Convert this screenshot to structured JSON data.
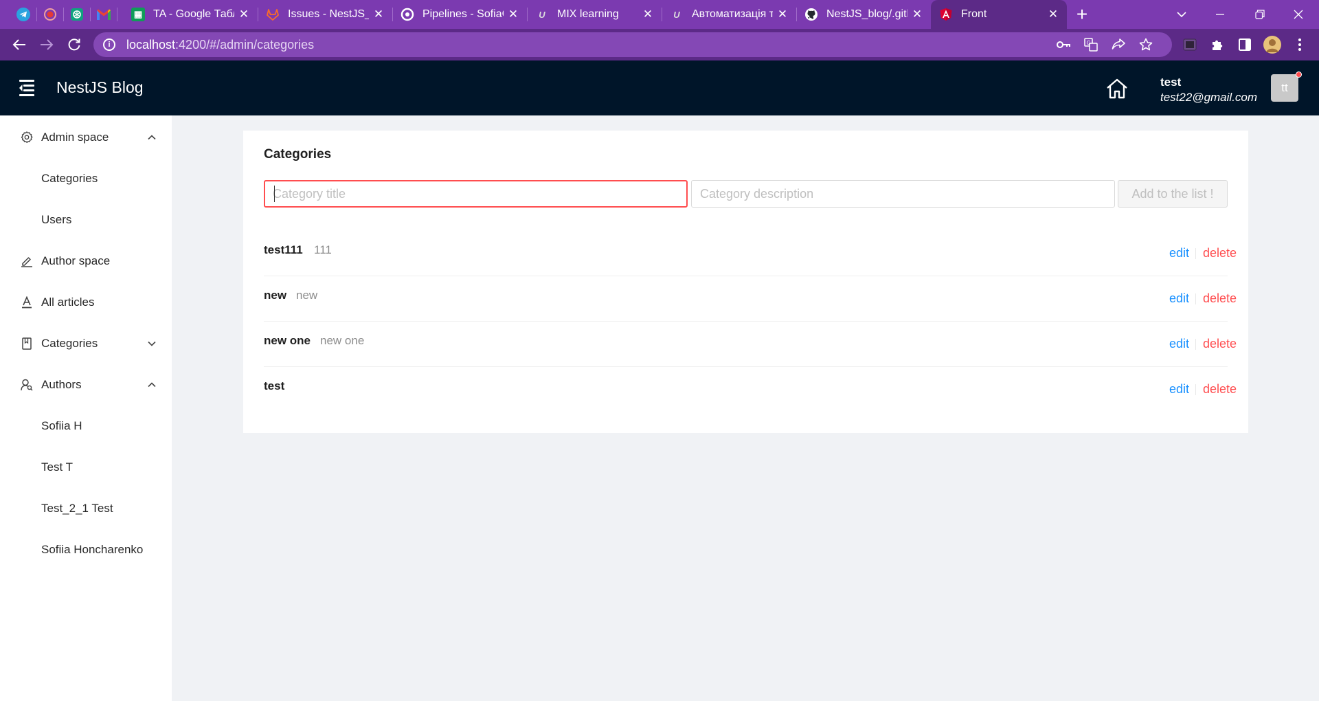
{
  "browser": {
    "tabs": [
      {
        "title": "TA - Google Табл",
        "icon": "google-sheets-icon"
      },
      {
        "title": "Issues - NestJS_bl",
        "icon": "gitlab-icon"
      },
      {
        "title": "Pipelines - SofiaG",
        "icon": "circleci-icon"
      },
      {
        "title": "MIX learning",
        "icon": "mix-icon"
      },
      {
        "title": "Автоматизація те",
        "icon": "mix-icon"
      },
      {
        "title": "NestJS_blog/.gith",
        "icon": "github-icon"
      },
      {
        "title": "Front",
        "icon": "angular-icon",
        "active": true
      }
    ],
    "pinned_icons": [
      "telegram-icon",
      "record-icon",
      "chatgpt-icon",
      "gmail-icon"
    ],
    "close_glyph": "✕",
    "newtab_glyph": "+",
    "url_host": "localhost",
    "url_path": ":4200/#/admin/categories",
    "colors": {
      "frame": "#7b3ab0",
      "toolbar": "#5c2a87"
    }
  },
  "header": {
    "brand": "NestJS Blog",
    "user_name": "test",
    "user_email": "test22@gmail.com",
    "avatar_initials": "tt",
    "colors": {
      "background": "#001529"
    }
  },
  "sidebar": {
    "admin_space": "Admin space",
    "admin_items": [
      "Categories",
      "Users"
    ],
    "author_space": "Author space",
    "all_articles": "All articles",
    "categories": "Categories",
    "authors": "Authors",
    "author_items": [
      "Sofiia H",
      "Test T",
      "Test_2_1 Test",
      "Sofiia Honcharenko"
    ]
  },
  "main": {
    "title": "Categories",
    "title_placeholder": "Category title",
    "description_placeholder": "Category description",
    "add_button": "Add to the list !",
    "edit_label": "edit",
    "delete_label": "delete",
    "categories": [
      {
        "title": "test111",
        "description": "111"
      },
      {
        "title": "new",
        "description": "new"
      },
      {
        "title": "new one",
        "description": "new one"
      },
      {
        "title": "test",
        "description": ""
      }
    ],
    "colors": {
      "edit": "#1890ff",
      "delete": "#ff4d4f",
      "error_border": "#ff4d4f"
    }
  }
}
